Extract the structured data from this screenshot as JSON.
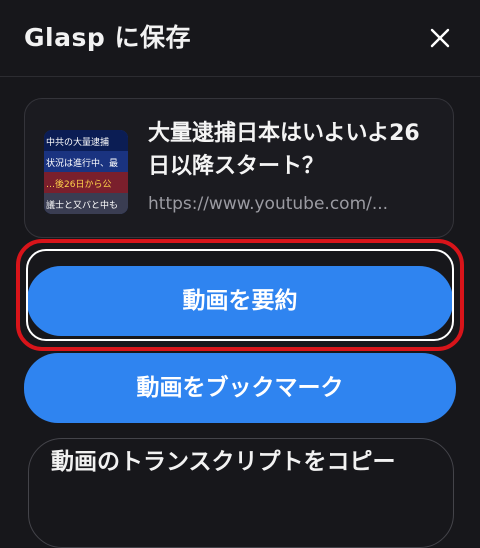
{
  "header": {
    "title": "Glasp に保存",
    "close_icon": "close-icon"
  },
  "video_card": {
    "title": "大量逮捕日本はいよいよ26日以降スタート？",
    "url": "https://www.youtube.com/...",
    "thumbnail_icon": "video-thumbnail",
    "thumbnail_lines": [
      "中共の大量逮捕",
      "状況は進行中、最",
      "…後26日から公",
      "議士と又バと中も"
    ]
  },
  "actions": {
    "summarize_label": "動画を要約",
    "bookmark_label": "動画をブックマーク",
    "copy_transcript_label": "動画のトランスクリプトをコピー"
  },
  "colors": {
    "background": "#17171b",
    "accent": "#2f84f0",
    "highlight": "#d8141a"
  }
}
